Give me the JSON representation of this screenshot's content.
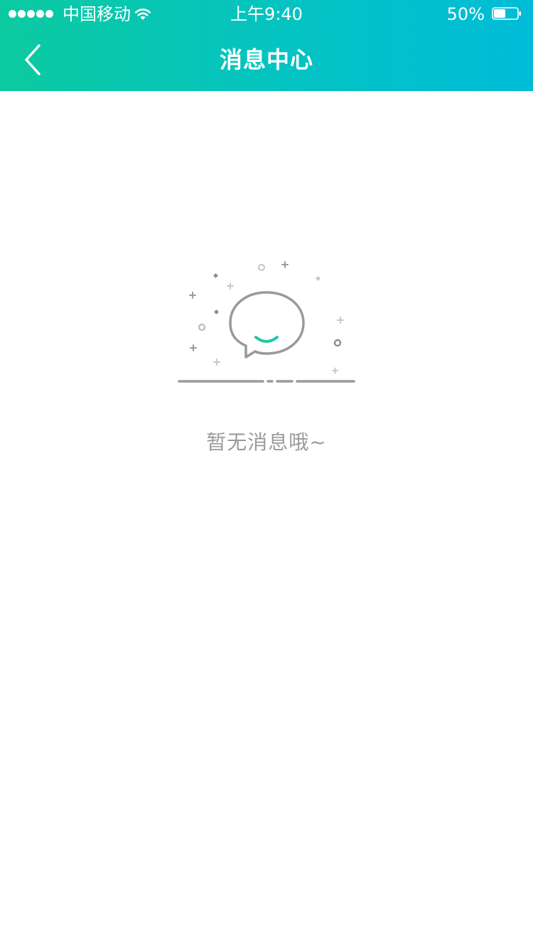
{
  "status_bar": {
    "carrier": "中国移动",
    "time": "上午9:40",
    "battery_percent": "50%",
    "battery_level": 0.5,
    "signal_strength": 5
  },
  "nav": {
    "title": "消息中心",
    "back_icon": "chevron-left-icon"
  },
  "empty_state": {
    "message": "暂无消息哦~",
    "illustration_icon": "smiling-chat-bubble-icon",
    "accent_color": "#1ec8a6"
  },
  "colors": {
    "header_gradient_start": "#0ccaa0",
    "header_gradient_end": "#00bcd8",
    "empty_text": "#9a9a9a",
    "illustration_stroke": "#999999"
  }
}
